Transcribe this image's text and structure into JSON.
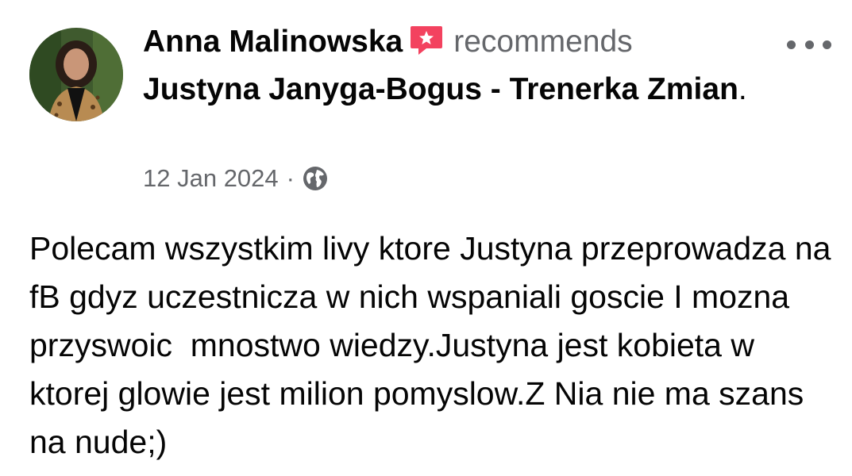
{
  "header": {
    "author_name": "Anna Malinowska",
    "action_text": "recommends",
    "page_name": "Justyna Janyga-Bogus - Trenerka Zmian",
    "period": "."
  },
  "meta": {
    "date": "12 Jan 2024",
    "separator": "·",
    "privacy_icon": "globe-icon"
  },
  "post": {
    "text": "Polecam wszystkim livy ktore Justyna przeprowadza na fB gdyz uczestnicza w nich wspaniali goscie I mozna przyswoic  mnostwo wiedzy.Justyna jest kobieta w ktorej glowie jest milion pomyslow.Z Nia nie ma szans na nude;)"
  },
  "icons": {
    "recommend_badge": "recommend-star-icon",
    "more": "more-options-icon"
  },
  "colors": {
    "primary_text": "#050505",
    "secondary_text": "#65676b",
    "recommend_badge": "#f3425f"
  }
}
